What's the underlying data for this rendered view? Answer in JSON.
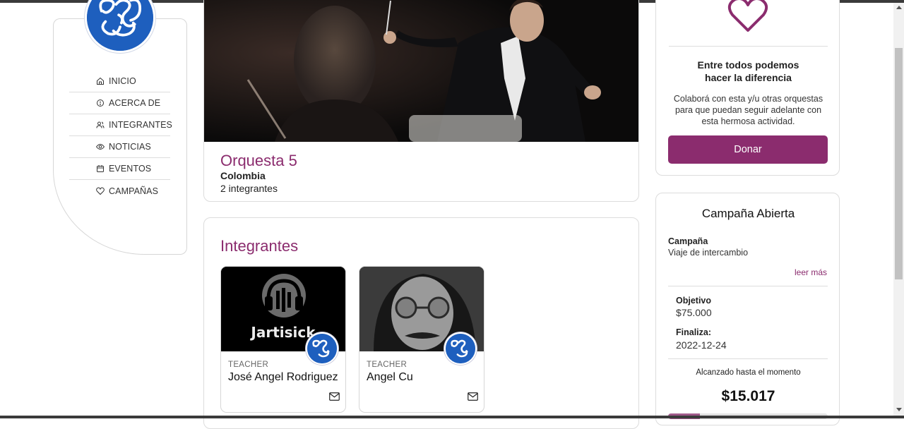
{
  "sidebar": {
    "logo_label": "logo",
    "items": [
      {
        "label": "INICIO",
        "icon": "home-icon"
      },
      {
        "label": "ACERCA DE",
        "icon": "info-icon"
      },
      {
        "label": "INTEGRANTES",
        "icon": "users-icon"
      },
      {
        "label": "NOTICIAS",
        "icon": "eye-icon"
      },
      {
        "label": "EVENTOS",
        "icon": "calendar-icon"
      },
      {
        "label": "CAMPAÑAS",
        "icon": "heart-icon"
      }
    ]
  },
  "orchestra": {
    "name": "Orquesta 5",
    "country": "Colombia",
    "members_count": "2 integrantes"
  },
  "members": {
    "title": "Integrantes",
    "list": [
      {
        "role": "TEACHER",
        "name": "José Angel Rodriguez",
        "image_text": "Jartisick"
      },
      {
        "role": "TEACHER",
        "name": "Angel Cu",
        "image_text": ""
      }
    ]
  },
  "donate": {
    "heading_line1": "Entre todos podemos",
    "heading_line2": "hacer la diferencia",
    "text": "Colaborá con esta y/u otras orquestas para que puedan seguir adelante con esta hermosa actividad.",
    "button_label": "Donar"
  },
  "campaign": {
    "title": "Campaña Abierta",
    "label": "Campaña",
    "name": "Viaje de intercambio",
    "read_more": "leer más",
    "goal_label": "Objetivo",
    "goal_value": "$75.000",
    "ends_label": "Finaliza:",
    "ends_value": "2022-12-24",
    "reached_label": "Alcanzado hasta el momento",
    "reached_value": "$15.017",
    "progress_fraction": 0.2
  },
  "colors": {
    "accent": "#8b2c6e",
    "logo_blue": "#1e5fbe"
  }
}
